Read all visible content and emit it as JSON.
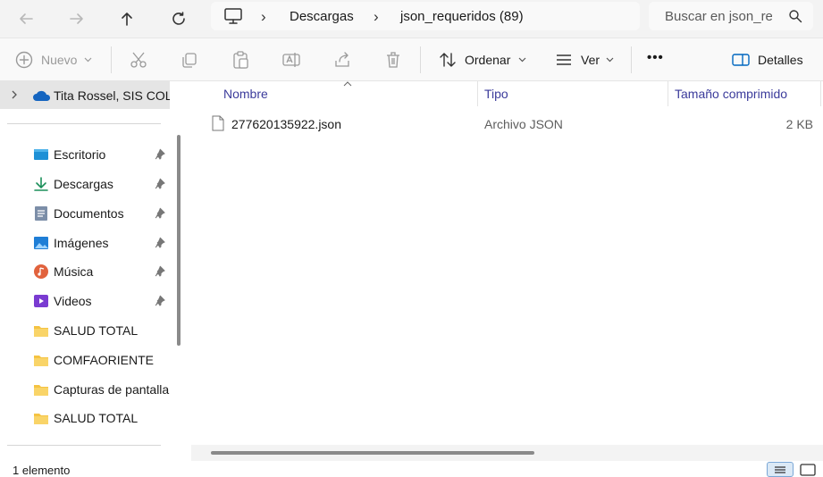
{
  "window": {
    "title": "json_requeridos (89)"
  },
  "navigation": {
    "back_icon": "arrow-left-icon",
    "forward_icon": "arrow-right-icon",
    "up_icon": "arrow-up-icon",
    "refresh_icon": "refresh-icon"
  },
  "address_bar": {
    "root_icon": "computer-icon",
    "breadcrumbs": [
      "Descargas",
      "json_requeridos (89)"
    ]
  },
  "search": {
    "placeholder": "Buscar en json_requeridos"
  },
  "toolbar": {
    "new_label": "Nuevo",
    "sort_label": "Ordenar",
    "view_label": "Ver",
    "more_label": "•••",
    "details_label": "Detalles"
  },
  "sidebar": {
    "cloud": {
      "label": "Tita Rossel, SIS COLOMBIA",
      "icon": "onedrive-cloud-icon"
    },
    "items": [
      {
        "label": "Escritorio",
        "icon": "desktop-icon",
        "pinned": true
      },
      {
        "label": "Descargas",
        "icon": "download-icon",
        "pinned": true
      },
      {
        "label": "Documentos",
        "icon": "documents-icon",
        "pinned": true
      },
      {
        "label": "Imágenes",
        "icon": "pictures-icon",
        "pinned": true
      },
      {
        "label": "Música",
        "icon": "music-icon",
        "pinned": true
      },
      {
        "label": "Videos",
        "icon": "videos-icon",
        "pinned": true
      },
      {
        "label": "SALUD TOTAL",
        "icon": "folder-icon",
        "pinned": false
      },
      {
        "label": "COMFAORIENTE",
        "icon": "folder-icon",
        "pinned": false
      },
      {
        "label": "Capturas de pantalla",
        "icon": "folder-icon",
        "pinned": false
      },
      {
        "label": "SALUD TOTAL",
        "icon": "folder-icon",
        "pinned": false
      }
    ]
  },
  "file_list": {
    "columns": [
      "Nombre",
      "Tipo",
      "Tamaño comprimido"
    ],
    "rows": [
      {
        "name": "277620135922.json",
        "type": "Archivo JSON",
        "size": "2 KB"
      }
    ]
  },
  "status_bar": {
    "count_text": "1 elemento"
  },
  "colors": {
    "folder": "#f5c342",
    "accent": "#0067c0",
    "column_header": "#3b3b9b"
  }
}
